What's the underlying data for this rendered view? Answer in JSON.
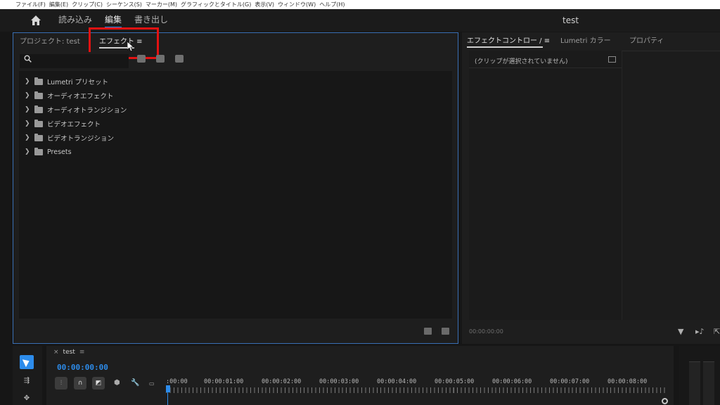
{
  "menu": [
    "ファイル(F)",
    "編集(E)",
    "クリップ(C)",
    "シーケンス(S)",
    "マーカー(M)",
    "グラフィックとタイトル(G)",
    "表示(V)",
    "ウィンドウ(W)",
    "ヘルプ(H)"
  ],
  "header": {
    "home_icon": "home-icon",
    "tabs": [
      "読み込み",
      "編集",
      "書き出し"
    ],
    "active_tab": "編集",
    "title": "test"
  },
  "left_panel": {
    "tabs": [
      {
        "label": "プロジェクト: test"
      },
      {
        "label": "エフェクト ≡"
      }
    ],
    "active_tab": "エフェクト",
    "search": {
      "placeholder": "",
      "value": ""
    },
    "tree": [
      {
        "label": "Lumetri プリセット",
        "icon": "preset-folder-icon"
      },
      {
        "label": "オーディオエフェクト",
        "icon": "folder-icon"
      },
      {
        "label": "オーディオトランジション",
        "icon": "folder-icon"
      },
      {
        "label": "ビデオエフェクト",
        "icon": "folder-icon"
      },
      {
        "label": "ビデオトランジション",
        "icon": "folder-icon"
      },
      {
        "label": "Presets",
        "icon": "preset-folder-icon"
      }
    ]
  },
  "right_panel": {
    "tabs": [
      {
        "label": "エフェクトコントロー / ≡"
      },
      {
        "label": "Lumetri カラー"
      },
      {
        "label": "プロパティ"
      }
    ],
    "message": "(クリップが選択されていません)",
    "timecode": "00:00:00:00"
  },
  "timeline": {
    "sequence_name": "test",
    "close_label": "×",
    "menu_label": "≡",
    "timecode": "00:00:00:00",
    "ruler_labels": [
      ":00:00",
      "00:00:01:00",
      "00:00:02:00",
      "00:00:03:00",
      "00:00:04:00",
      "00:00:05:00",
      "00:00:06:00",
      "00:00:07:00",
      "00:00:08:00"
    ]
  },
  "colors": {
    "accent": "#2d8ceb",
    "highlight": "#e31212"
  }
}
